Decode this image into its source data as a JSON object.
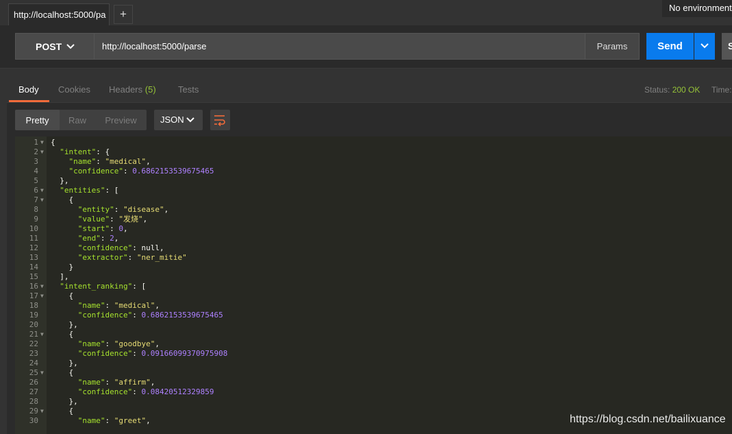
{
  "tab": {
    "title": "http://localhost:5000/pa",
    "add_label": "+"
  },
  "environment": {
    "selected": "No environment"
  },
  "request": {
    "method": "POST",
    "url": "http://localhost:5000/parse",
    "params_label": "Params",
    "send_label": "Send",
    "save_label": "S"
  },
  "response": {
    "tabs": [
      {
        "label": "Body",
        "active": true
      },
      {
        "label": "Cookies"
      },
      {
        "label": "Headers",
        "count": "(5)"
      },
      {
        "label": "Tests"
      }
    ],
    "status_label": "Status:",
    "status_value": "200 OK",
    "time_label": "Time:",
    "view_modes": [
      "Pretty",
      "Raw",
      "Preview"
    ],
    "format": "JSON",
    "wrap_icon": "wrap-lines-icon"
  },
  "code_lines": [
    {
      "n": "1",
      "fold": true,
      "text": [
        [
          "p",
          "{"
        ]
      ]
    },
    {
      "n": "2",
      "fold": true,
      "text": [
        [
          "p",
          "  "
        ],
        [
          "k",
          "\"intent\""
        ],
        [
          "p",
          ": {"
        ]
      ]
    },
    {
      "n": "3",
      "text": [
        [
          "p",
          "    "
        ],
        [
          "k",
          "\"name\""
        ],
        [
          "p",
          ": "
        ],
        [
          "s",
          "\"medical\""
        ],
        [
          "p",
          ","
        ]
      ]
    },
    {
      "n": "4",
      "text": [
        [
          "p",
          "    "
        ],
        [
          "k",
          "\"confidence\""
        ],
        [
          "p",
          ": "
        ],
        [
          "n",
          "0.6862153539675465"
        ]
      ]
    },
    {
      "n": "5",
      "text": [
        [
          "p",
          "  },"
        ]
      ]
    },
    {
      "n": "6",
      "fold": true,
      "text": [
        [
          "p",
          "  "
        ],
        [
          "k",
          "\"entities\""
        ],
        [
          "p",
          ": ["
        ]
      ]
    },
    {
      "n": "7",
      "fold": true,
      "text": [
        [
          "p",
          "    {"
        ]
      ]
    },
    {
      "n": "8",
      "text": [
        [
          "p",
          "      "
        ],
        [
          "k",
          "\"entity\""
        ],
        [
          "p",
          ": "
        ],
        [
          "s",
          "\"disease\""
        ],
        [
          "p",
          ","
        ]
      ]
    },
    {
      "n": "9",
      "text": [
        [
          "p",
          "      "
        ],
        [
          "k",
          "\"value\""
        ],
        [
          "p",
          ": "
        ],
        [
          "s",
          "\"发烧\""
        ],
        [
          "p",
          ","
        ]
      ]
    },
    {
      "n": "10",
      "text": [
        [
          "p",
          "      "
        ],
        [
          "k",
          "\"start\""
        ],
        [
          "p",
          ": "
        ],
        [
          "n",
          "0"
        ],
        [
          "p",
          ","
        ]
      ]
    },
    {
      "n": "11",
      "text": [
        [
          "p",
          "      "
        ],
        [
          "k",
          "\"end\""
        ],
        [
          "p",
          ": "
        ],
        [
          "n",
          "2"
        ],
        [
          "p",
          ","
        ]
      ]
    },
    {
      "n": "12",
      "text": [
        [
          "p",
          "      "
        ],
        [
          "k",
          "\"confidence\""
        ],
        [
          "p",
          ": null,"
        ]
      ]
    },
    {
      "n": "13",
      "text": [
        [
          "p",
          "      "
        ],
        [
          "k",
          "\"extractor\""
        ],
        [
          "p",
          ": "
        ],
        [
          "s",
          "\"ner_mitie\""
        ]
      ]
    },
    {
      "n": "14",
      "text": [
        [
          "p",
          "    }"
        ]
      ]
    },
    {
      "n": "15",
      "text": [
        [
          "p",
          "  ],"
        ]
      ]
    },
    {
      "n": "16",
      "fold": true,
      "text": [
        [
          "p",
          "  "
        ],
        [
          "k",
          "\"intent_ranking\""
        ],
        [
          "p",
          ": ["
        ]
      ]
    },
    {
      "n": "17",
      "fold": true,
      "text": [
        [
          "p",
          "    {"
        ]
      ]
    },
    {
      "n": "18",
      "text": [
        [
          "p",
          "      "
        ],
        [
          "k",
          "\"name\""
        ],
        [
          "p",
          ": "
        ],
        [
          "s",
          "\"medical\""
        ],
        [
          "p",
          ","
        ]
      ]
    },
    {
      "n": "19",
      "text": [
        [
          "p",
          "      "
        ],
        [
          "k",
          "\"confidence\""
        ],
        [
          "p",
          ": "
        ],
        [
          "n",
          "0.6862153539675465"
        ]
      ]
    },
    {
      "n": "20",
      "text": [
        [
          "p",
          "    },"
        ]
      ]
    },
    {
      "n": "21",
      "fold": true,
      "text": [
        [
          "p",
          "    {"
        ]
      ]
    },
    {
      "n": "22",
      "text": [
        [
          "p",
          "      "
        ],
        [
          "k",
          "\"name\""
        ],
        [
          "p",
          ": "
        ],
        [
          "s",
          "\"goodbye\""
        ],
        [
          "p",
          ","
        ]
      ]
    },
    {
      "n": "23",
      "text": [
        [
          "p",
          "      "
        ],
        [
          "k",
          "\"confidence\""
        ],
        [
          "p",
          ": "
        ],
        [
          "n",
          "0.09166099370975908"
        ]
      ]
    },
    {
      "n": "24",
      "text": [
        [
          "p",
          "    },"
        ]
      ]
    },
    {
      "n": "25",
      "fold": true,
      "text": [
        [
          "p",
          "    {"
        ]
      ]
    },
    {
      "n": "26",
      "text": [
        [
          "p",
          "      "
        ],
        [
          "k",
          "\"name\""
        ],
        [
          "p",
          ": "
        ],
        [
          "s",
          "\"affirm\""
        ],
        [
          "p",
          ","
        ]
      ]
    },
    {
      "n": "27",
      "text": [
        [
          "p",
          "      "
        ],
        [
          "k",
          "\"confidence\""
        ],
        [
          "p",
          ": "
        ],
        [
          "n",
          "0.08420512329859"
        ]
      ]
    },
    {
      "n": "28",
      "text": [
        [
          "p",
          "    },"
        ]
      ]
    },
    {
      "n": "29",
      "fold": true,
      "text": [
        [
          "p",
          "    {"
        ]
      ]
    },
    {
      "n": "30",
      "text": [
        [
          "p",
          "      "
        ],
        [
          "k",
          "\"name\""
        ],
        [
          "p",
          ": "
        ],
        [
          "s",
          "\"greet\""
        ],
        [
          "p",
          ","
        ]
      ]
    }
  ],
  "watermark": "https://blog.csdn.net/bailixuance",
  "colors": {
    "accent": "#f26b3a",
    "send": "#097bed",
    "status_ok": "#95c238",
    "json_key": "#a6e22e",
    "json_string": "#e6db74",
    "json_number": "#ae81ff"
  }
}
